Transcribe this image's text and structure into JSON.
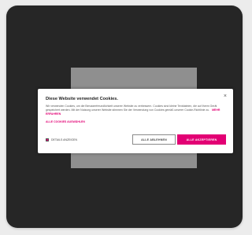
{
  "dialog": {
    "title": "Diese Website verwendet Cookies.",
    "description": "Wir verwenden Cookies, um die Benutzerfreundlichkeit unserer Website zu verbessern. Cookies sind kleine Textdateien, die auf Ihrem Gerät gespeichert werden. Mit der Nutzung unserer Website stimmen Sie der Verwendung von Cookies gemäß unserer Cookie-Richtlinie zu.",
    "more_info_link": "MEHR ERFAHREN",
    "select_link": "ALLE COOKIES AUSWÄHLEN",
    "close_glyph": "×",
    "checkbox_label": "DETAILS ANZEIGEN",
    "secondary_button": "ALLE ABLEHNEN",
    "primary_button": "ALLE AKZEPTIEREN"
  },
  "colors": {
    "accent": "#e20074",
    "card_background": "#262626",
    "backdrop_panel": "#8f8f8f"
  }
}
